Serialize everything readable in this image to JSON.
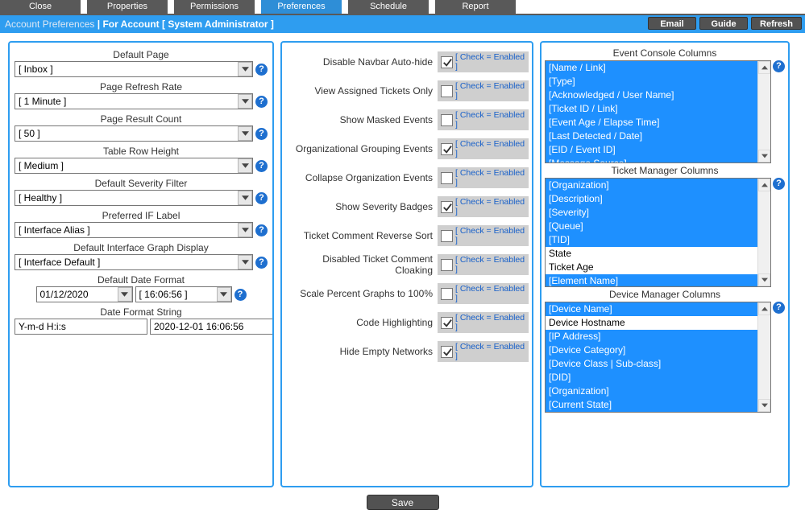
{
  "tabs": {
    "close": "Close",
    "properties": "Properties",
    "permissions": "Permissions",
    "preferences": "Preferences",
    "schedule": "Schedule",
    "report": "Report"
  },
  "header": {
    "title1": "Account Preferences",
    "sep": " | ",
    "title2": "For Account [ System Administrator ]",
    "buttons": {
      "email": "Email",
      "guide": "Guide",
      "refresh": "Refresh"
    }
  },
  "left": {
    "default_page": {
      "label": "Default Page",
      "value": "[ Inbox ]"
    },
    "refresh_rate": {
      "label": "Page Refresh Rate",
      "value": "[ 1 Minute ]"
    },
    "result_count": {
      "label": "Page Result Count",
      "value": "[ 50 ]"
    },
    "row_height": {
      "label": "Table Row Height",
      "value": "[ Medium ]"
    },
    "severity_filter": {
      "label": "Default Severity Filter",
      "value": "[ Healthy ]"
    },
    "if_label": {
      "label": "Preferred IF Label",
      "value": "[ Interface Alias ]"
    },
    "graph_display": {
      "label": "Default Interface Graph Display",
      "value": "[ Interface Default ]"
    },
    "date_format": {
      "label": "Default Date Format",
      "date": "01/12/2020",
      "time": "[ 16:06:56 ]"
    },
    "format_string": {
      "label": "Date Format String",
      "value": "Y-m-d H:i:s",
      "sample": "2020-12-01 16:06:56"
    }
  },
  "mid": {
    "hint": "[ Check = Enabled ]",
    "items": [
      {
        "label": "Disable Navbar Auto-hide",
        "checked": true
      },
      {
        "label": "View Assigned Tickets Only",
        "checked": false
      },
      {
        "label": "Show Masked Events",
        "checked": false
      },
      {
        "label": "Organizational Grouping Events",
        "checked": true
      },
      {
        "label": "Collapse Organization Events",
        "checked": false
      },
      {
        "label": "Show Severity Badges",
        "checked": true
      },
      {
        "label": "Ticket Comment Reverse Sort",
        "checked": false
      },
      {
        "label": "Disabled Ticket Comment Cloaking",
        "checked": false
      },
      {
        "label": "Scale Percent Graphs to 100%",
        "checked": false
      },
      {
        "label": "Code Highlighting",
        "checked": true
      },
      {
        "label": "Hide Empty Networks",
        "checked": true
      }
    ]
  },
  "right": {
    "event_label": "Event Console Columns",
    "event_items": [
      {
        "text": "[Name / Link]",
        "sel": true
      },
      {
        "text": "[Type]",
        "sel": true
      },
      {
        "text": "[Acknowledged / User Name]",
        "sel": true
      },
      {
        "text": "[Ticket ID / Link]",
        "sel": true
      },
      {
        "text": "[Event Age / Elapse Time]",
        "sel": true
      },
      {
        "text": "[Last Detected / Date]",
        "sel": true
      },
      {
        "text": "[EID / Event ID]",
        "sel": true
      },
      {
        "text": "[Message Source]",
        "sel": true
      }
    ],
    "ticket_label": "Ticket Manager Columns",
    "ticket_items": [
      {
        "text": "[Organization]",
        "sel": true
      },
      {
        "text": "[Description]",
        "sel": true
      },
      {
        "text": "[Severity]",
        "sel": true
      },
      {
        "text": "[Queue]",
        "sel": true
      },
      {
        "text": "[TID]",
        "sel": true
      },
      {
        "text": "State",
        "sel": false
      },
      {
        "text": "Ticket Age",
        "sel": false
      },
      {
        "text": "[Element Name]",
        "sel": true
      }
    ],
    "device_label": "Device Manager Columns",
    "device_items": [
      {
        "text": "[Device Name]",
        "sel": true
      },
      {
        "text": "Device Hostname",
        "sel": false
      },
      {
        "text": "[IP Address]",
        "sel": true
      },
      {
        "text": "[Device Category]",
        "sel": true
      },
      {
        "text": "[Device Class | Sub-class]",
        "sel": true
      },
      {
        "text": "[DID]",
        "sel": true
      },
      {
        "text": "[Organization]",
        "sel": true
      },
      {
        "text": "[Current State]",
        "sel": true
      }
    ]
  },
  "footer": {
    "save": "Save"
  }
}
